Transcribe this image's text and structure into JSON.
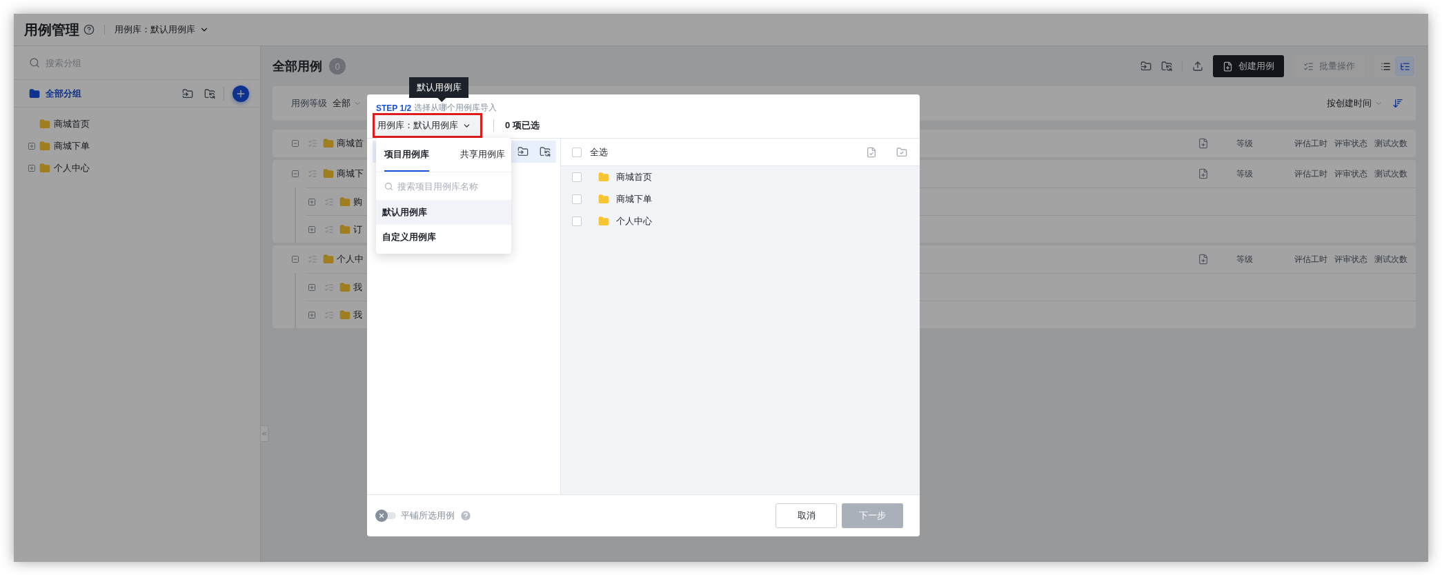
{
  "header": {
    "title": "用例管理",
    "library": "用例库：默认用例库"
  },
  "sidebar": {
    "search_placeholder": "搜索分组",
    "root": "全部分组",
    "tree": [
      {
        "label": "商城首页",
        "expandable": false
      },
      {
        "label": "商城下单",
        "expandable": true
      },
      {
        "label": "个人中心",
        "expandable": true
      }
    ]
  },
  "main": {
    "title": "全部用例",
    "count": "0",
    "buttons": [
      {
        "label": "创建用例",
        "kind": "primary",
        "disabled": false
      },
      {
        "label": "批量操作",
        "kind": "batch",
        "disabled": true
      }
    ],
    "views": [
      {
        "kind": "list",
        "selected": false
      },
      {
        "kind": "tree",
        "selected": true
      }
    ],
    "filter": {
      "label": "用例等级",
      "value": "全部"
    },
    "sort": "按创建时间",
    "groups": [
      {
        "label": "商城首",
        "expanded": true,
        "columns": [
          "等级",
          "评估工时",
          "评审状态",
          "测试次数"
        ]
      },
      {
        "label": "商城下",
        "expanded": true,
        "columns": [
          "等级",
          "评估工时",
          "评审状态",
          "测试次数"
        ],
        "children": [
          {
            "label": "购",
            "expanded": false
          },
          {
            "label": "订",
            "expanded": false
          }
        ]
      },
      {
        "label": "个人中",
        "expanded": true,
        "columns": [
          "等级",
          "评估工时",
          "评审状态",
          "测试次数"
        ],
        "children": [
          {
            "label": "我",
            "expanded": false
          },
          {
            "label": "我",
            "expanded": false
          }
        ]
      }
    ]
  },
  "modal": {
    "tooltip": "默认用例库",
    "step": "STEP 1/2",
    "step_hint": "选择从哪个用例库导入",
    "library_select": "用例库：默认用例库",
    "selected_count": "0 项已选",
    "dropdown": {
      "tabs": [
        {
          "label": "项目用例库",
          "selected": true
        },
        {
          "label": "共享用例库",
          "selected": false
        }
      ],
      "search_placeholder": "搜索项目用例库名称",
      "items": [
        {
          "label": "默认用例库",
          "selected": true
        },
        {
          "label": "自定义用例库",
          "selected": false
        }
      ]
    },
    "select_all": {
      "label": "全选",
      "checked": false
    },
    "groups": [
      {
        "label": "商城首页",
        "checked": false
      },
      {
        "label": "商城下单",
        "checked": false
      },
      {
        "label": "个人中心",
        "checked": false
      }
    ],
    "tile_toggle": {
      "label": "平铺所选用例",
      "on": false
    },
    "cancel": "取消",
    "next": {
      "label": "下一步",
      "disabled": true
    }
  }
}
